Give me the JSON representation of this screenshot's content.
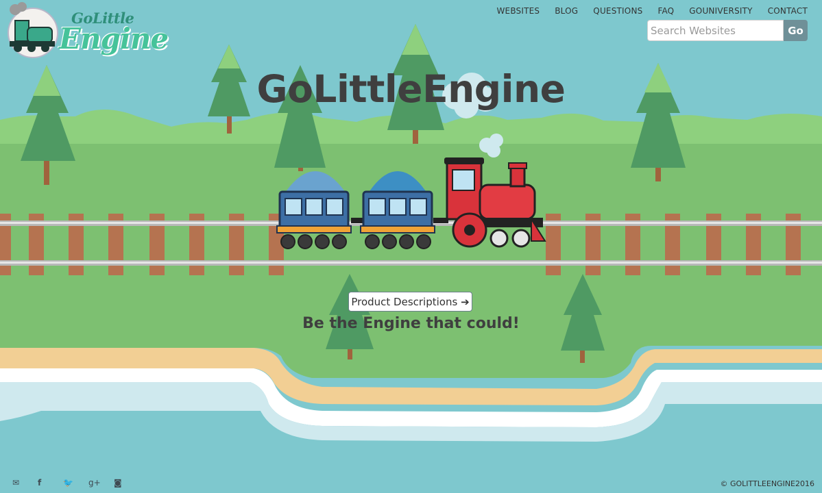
{
  "logo": {
    "line1": "GoLittle",
    "line2": "Engine"
  },
  "nav": [
    "WEBSITES",
    "BLOG",
    "QUESTIONS",
    "FAQ",
    "GOUNIVERSITY",
    "CONTACT"
  ],
  "search": {
    "placeholder": "Search Websites",
    "button": "Go"
  },
  "hero": {
    "title": "GoLittleEngine",
    "cta": "Product Descriptions",
    "cta_icon": "arrow-right-icon",
    "tagline": "Be the Engine that could!"
  },
  "footer": {
    "social_icons": [
      "envelope-icon",
      "facebook-icon",
      "twitter-icon",
      "google-plus-icon",
      "instagram-icon"
    ],
    "copyright": "© GOLITTLEENGINE2016"
  },
  "colors": {
    "sky": "#7ec8ce",
    "grass": "#7dc071",
    "tree": "#4f9a63",
    "rail_tie": "#b57350",
    "engine": "#d9333b",
    "carriage": "#3d6fa5"
  }
}
